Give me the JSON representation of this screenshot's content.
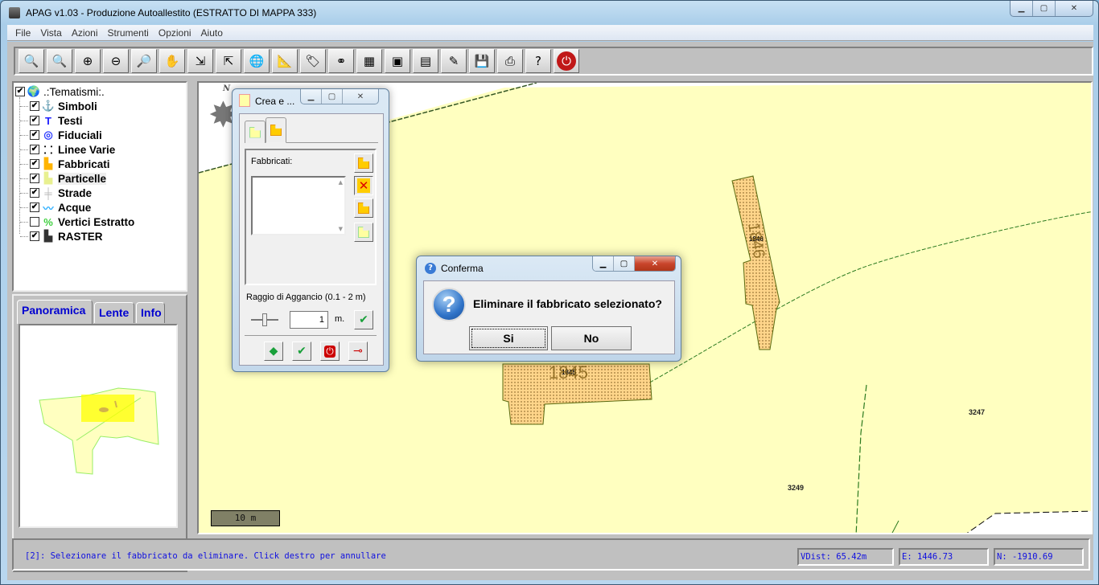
{
  "window": {
    "title": "APAG v1.03 - Produzione Autoallestito (ESTRATTO DI MAPPA 333)",
    "minimize": "▁",
    "maximize": "▢",
    "close": "✕"
  },
  "menu": [
    "File",
    "Vista",
    "Azioni",
    "Strumenti",
    "Opzioni",
    "Aiuto"
  ],
  "toolbar": [
    {
      "name": "zoom-previous-icon",
      "glyph": "🔍"
    },
    {
      "name": "zoom-next-icon",
      "glyph": "🔍"
    },
    {
      "name": "zoom-in-icon",
      "glyph": "⊕"
    },
    {
      "name": "zoom-out-icon",
      "glyph": "⊖"
    },
    {
      "name": "zoom-window-icon",
      "glyph": "🔎"
    },
    {
      "name": "pan-hand-icon",
      "glyph": "✋"
    },
    {
      "name": "zoom-extents-in-icon",
      "glyph": "⇲"
    },
    {
      "name": "zoom-extents-out-icon",
      "glyph": "⇱"
    },
    {
      "name": "globe-zoom-icon",
      "glyph": "🌐"
    },
    {
      "name": "ruler-icon",
      "glyph": "📐"
    },
    {
      "name": "label-tag-icon",
      "glyph": "🏷"
    },
    {
      "name": "binoculars-icon",
      "glyph": "⚭"
    },
    {
      "name": "layers-icon",
      "glyph": "▦"
    },
    {
      "name": "find-parcel-icon",
      "glyph": "▣"
    },
    {
      "name": "table-icon",
      "glyph": "▤"
    },
    {
      "name": "edit-parcel-icon",
      "glyph": "✎"
    },
    {
      "name": "save-disk-icon",
      "glyph": "💾"
    },
    {
      "name": "print-icon",
      "glyph": "⎙"
    },
    {
      "name": "help-icon",
      "glyph": "?"
    },
    {
      "name": "power-exit-icon",
      "glyph": "⏻"
    }
  ],
  "tree": {
    "root": {
      "label": ".:Tematismi:.",
      "checked": "✔"
    },
    "items": [
      {
        "label": "Simboli",
        "checked": "✔",
        "icon": "⚓",
        "color": "#2020ff"
      },
      {
        "label": "Testi",
        "checked": "✔",
        "icon": "T",
        "color": "#2020ff"
      },
      {
        "label": "Fiduciali",
        "checked": "✔",
        "icon": "◎",
        "color": "#3040ff"
      },
      {
        "label": "Linee Varie",
        "checked": "✔",
        "icon": "⸬",
        "color": "#000000"
      },
      {
        "label": "Fabbricati",
        "checked": "✔",
        "icon": "▙",
        "color": "#ffb400"
      },
      {
        "label": "Particelle",
        "checked": "✔",
        "icon": "▙",
        "color": "#e8f090"
      },
      {
        "label": "Strade",
        "checked": "✔",
        "icon": "╪",
        "color": "#bbbbbb"
      },
      {
        "label": "Acque",
        "checked": "✔",
        "icon": "〰",
        "color": "#30b0ff"
      },
      {
        "label": "Vertici Estratto",
        "checked": "",
        "icon": "%",
        "color": "#40d040"
      },
      {
        "label": "RASTER",
        "checked": "✔",
        "icon": "▙",
        "color": "#333333"
      }
    ]
  },
  "bottom_tabs": [
    "Panoramica",
    "Lente",
    "Info"
  ],
  "map": {
    "north_label": "N",
    "scale_label": "10 m",
    "parcels": [
      "3247",
      "3249"
    ],
    "buildings": [
      "1846",
      "1845"
    ],
    "building_large_labels": [
      "1845",
      "1846"
    ]
  },
  "tool_window": {
    "title": "Crea e ...",
    "group_label": "Fabbricati:",
    "snap_label": "Raggio di Aggancio (0.1 - 2 m)",
    "snap_value": "1",
    "unit": "m."
  },
  "dialog": {
    "title": "Conferma",
    "message": "Eliminare il fabbricato selezionato?",
    "yes": "Si",
    "no": "No"
  },
  "status": {
    "message": "[2]: Selezionare il fabbricato da eliminare. Click destro per annullare",
    "vdist": "VDist: 65.42m",
    "east": "E: 1446.73",
    "north": "N: -1910.69"
  }
}
